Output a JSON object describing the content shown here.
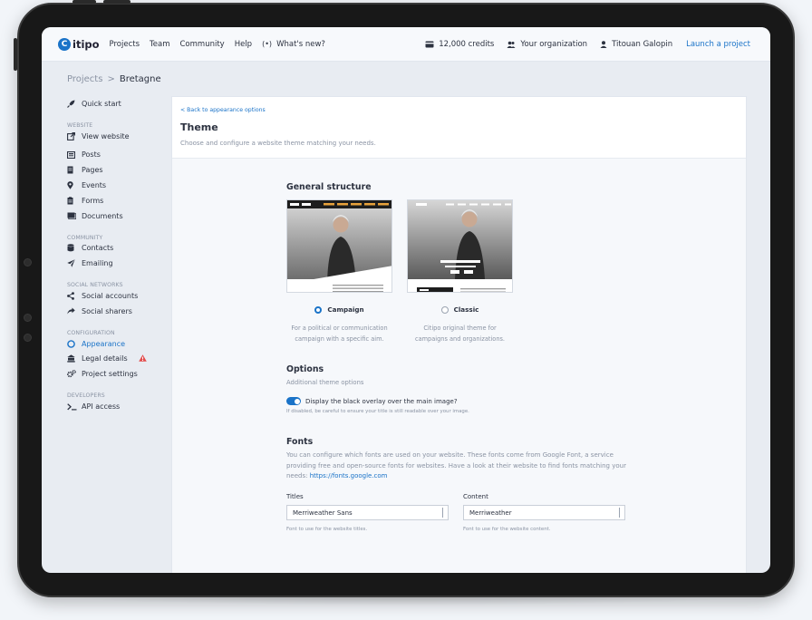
{
  "topbar": {
    "logo": "itipo",
    "logo_mark": "C",
    "nav": [
      "Projects",
      "Team",
      "Community",
      "Help"
    ],
    "whats_new": "What's new?",
    "credits": "12,000 credits",
    "organization": "Your organization",
    "user": "Titouan Galopin",
    "launch": "Launch a project"
  },
  "breadcrumb": {
    "parent": "Projects",
    "separator": ">",
    "current": "Bretagne"
  },
  "sidebar": {
    "quick_start": "Quick start",
    "sections": {
      "website": "Website",
      "community": "Community",
      "social": "Social networks",
      "configuration": "Configuration",
      "developers": "Developers"
    },
    "items": {
      "view_website": "View website",
      "posts": "Posts",
      "pages": "Pages",
      "events": "Events",
      "forms": "Forms",
      "documents": "Documents",
      "contacts": "Contacts",
      "emailing": "Emailing",
      "social_accounts": "Social accounts",
      "social_sharers": "Social sharers",
      "appearance": "Appearance",
      "legal_details": "Legal details",
      "project_settings": "Project settings",
      "api_access": "API access"
    },
    "active_color": "#1a73c8"
  },
  "panel": {
    "back_link": "< Back to appearance options",
    "title": "Theme",
    "subtitle": "Choose and configure a website theme matching your needs."
  },
  "structure": {
    "heading": "General structure",
    "themes": [
      {
        "name": "Campaign",
        "selected": true,
        "desc": "For a political or communication campaign with a specific aim."
      },
      {
        "name": "Classic",
        "selected": false,
        "desc": "Citipo original theme for campaigns and organizations."
      }
    ]
  },
  "options": {
    "heading": "Options",
    "subheading": "Additional theme options",
    "overlay_label": "Display the black overlay over the main image?",
    "overlay_enabled": true,
    "overlay_hint": "If disabled, be careful to ensure your title is still readable over your image."
  },
  "fonts": {
    "heading": "Fonts",
    "desc": "You can configure which fonts are used on your website. These fonts come from Google Font, a service providing free and open-source fonts for websites. Have a look at their website to find fonts matching your needs: ",
    "link": "https://fonts.google.com",
    "titles_label": "Titles",
    "titles_value": "Merriweather Sans",
    "titles_hint": "Font to use for the website titles.",
    "content_label": "Content",
    "content_value": "Merriweather",
    "content_hint": "Font to use for the website content."
  }
}
